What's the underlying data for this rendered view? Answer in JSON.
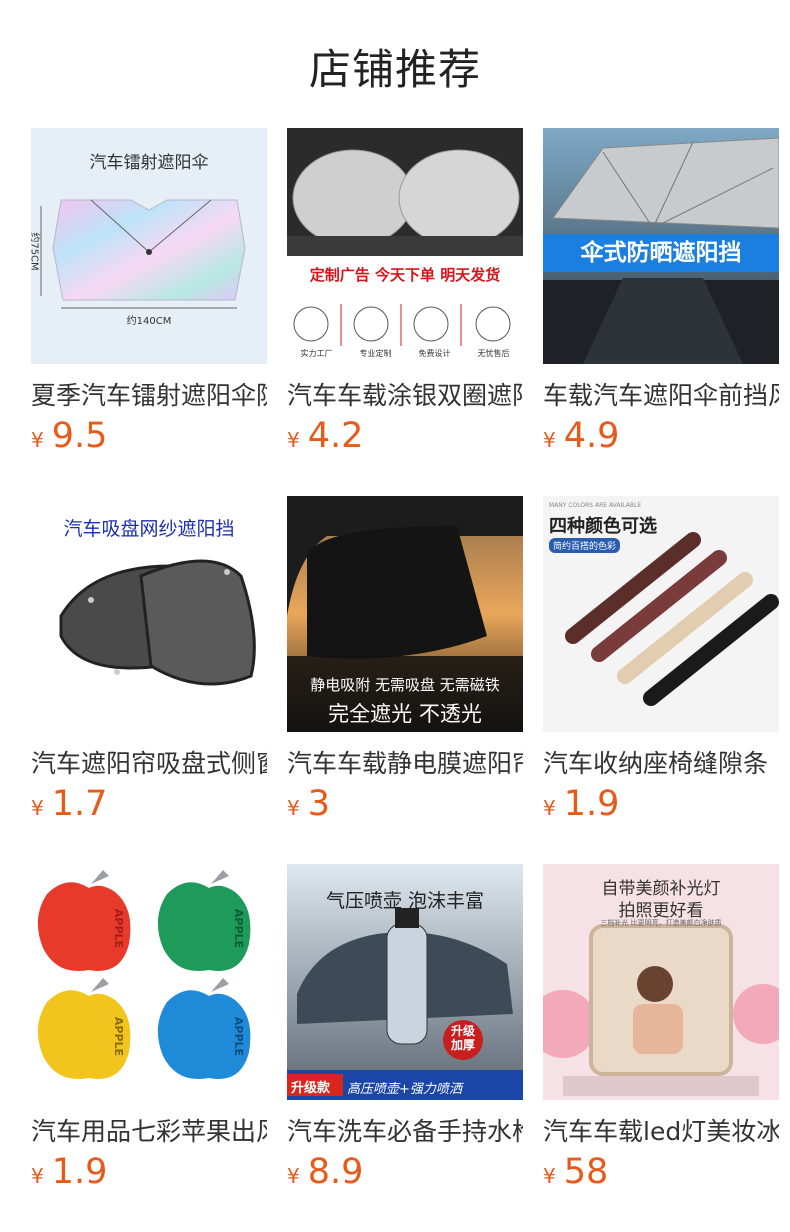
{
  "title": "店铺推荐",
  "colors": {
    "price": "#e85a1a",
    "text": "#333333"
  },
  "products": [
    {
      "name": "夏季汽车镭射遮阳伞防晒隔热",
      "currency": "¥",
      "price": "9.5",
      "image": {
        "headline": "汽车镭射遮阳伞",
        "width_label": "约140CM",
        "height_label": "约75CM"
      }
    },
    {
      "name": "汽车车载涂银双圈遮阳挡",
      "currency": "¥",
      "price": "4.2",
      "image": {
        "headline": "定制广告 今天下单 明天发货",
        "badges": [
          "实力工厂",
          "专业定制",
          "免费设计",
          "无忧售后"
        ]
      }
    },
    {
      "name": "车载汽车遮阳伞前挡风玻璃",
      "currency": "¥",
      "price": "4.9",
      "image": {
        "headline": "伞式防晒遮阳挡"
      }
    },
    {
      "name": "汽车遮阳帘吸盘式侧窗",
      "currency": "¥",
      "price": "1.7",
      "image": {
        "headline": "汽车吸盘网纱遮阳挡"
      }
    },
    {
      "name": "汽车车载静电膜遮阳帘",
      "currency": "¥",
      "price": "3",
      "image": {
        "line1": "静电吸附 无需吸盘 无需磁铁",
        "line2": "完全遮光 不透光"
      }
    },
    {
      "name": "汽车收纳座椅缝隙条",
      "currency": "¥",
      "price": "1.9",
      "image": {
        "top_note": "MANY COLORS ARE AVAILABLE",
        "headline": "四种颜色可选",
        "tag": "简约百搭的色彩"
      }
    },
    {
      "name": "汽车用品七彩苹果出风口",
      "currency": "¥",
      "price": "1.9",
      "image": {
        "brand": "APPLE"
      }
    },
    {
      "name": "汽车洗车必备手持水枪",
      "currency": "¥",
      "price": "8.9",
      "image": {
        "headline": "气压喷壶 泡沫丰富",
        "badge": "升级加厚",
        "tag": "升级款",
        "footer": "高压喷壶+强力喷洒"
      }
    },
    {
      "name": "汽车车载led灯美妆冰箱",
      "currency": "¥",
      "price": "58",
      "image": {
        "headline1": "自带美颜补光灯",
        "headline2": "拍照更好看",
        "sub": "三档补光 比更明亮，打造美颜白净肤质"
      }
    }
  ]
}
